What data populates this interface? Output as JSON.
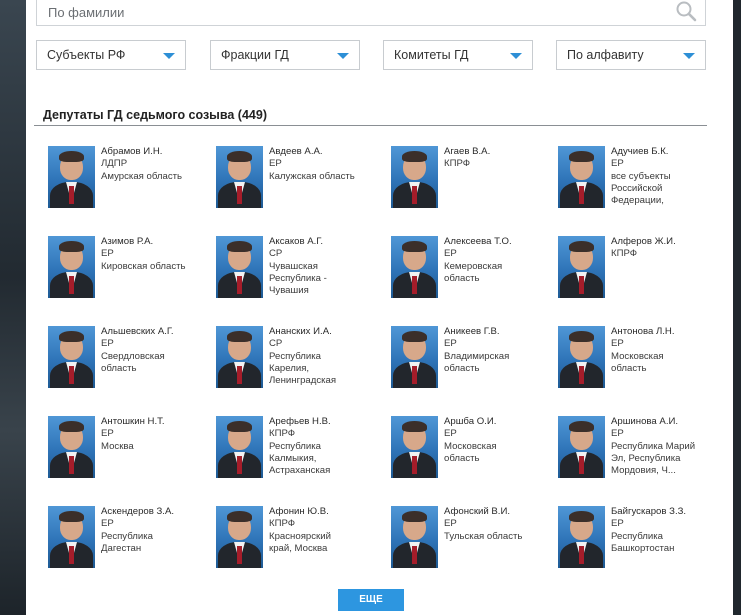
{
  "search": {
    "placeholder": "По фамилии"
  },
  "filters": [
    {
      "label": "Субъекты РФ"
    },
    {
      "label": "Фракции ГД"
    },
    {
      "label": "Комитеты ГД"
    },
    {
      "label": "По алфавиту"
    }
  ],
  "section": {
    "title": "Депутаты ГД седьмого созыва (449)"
  },
  "deputies": [
    {
      "name": "Абрамов И.Н.",
      "party": "ЛДПР",
      "region": [
        "Амурская область"
      ]
    },
    {
      "name": "Авдеев А.А.",
      "party": "ЕР",
      "region": [
        "Калужская область"
      ]
    },
    {
      "name": "Агаев В.А.",
      "party": "КПРФ",
      "region": []
    },
    {
      "name": "Адучиев Б.К.",
      "party": "ЕР",
      "region": [
        "все субъекты",
        "Российской",
        "Федерации,"
      ]
    },
    {
      "name": "Азимов Р.А.",
      "party": "ЕР",
      "region": [
        "Кировская область"
      ]
    },
    {
      "name": "Аксаков А.Г.",
      "party": "СР",
      "region": [
        "Чувашская",
        "Республика -",
        "Чувашия"
      ]
    },
    {
      "name": "Алексеева Т.О.",
      "party": "ЕР",
      "region": [
        "Кемеровская",
        "область"
      ]
    },
    {
      "name": "Алферов Ж.И.",
      "party": "КПРФ",
      "region": []
    },
    {
      "name": "Альшевских А.Г.",
      "party": "ЕР",
      "region": [
        "Свердловская",
        "область"
      ]
    },
    {
      "name": "Ананских И.А.",
      "party": "СР",
      "region": [
        "Республика",
        "Карелия,",
        "Ленинградская"
      ]
    },
    {
      "name": "Аникеев Г.В.",
      "party": "ЕР",
      "region": [
        "Владимирская",
        "область"
      ]
    },
    {
      "name": "Антонова Л.Н.",
      "party": "ЕР",
      "region": [
        "Московская",
        "область"
      ]
    },
    {
      "name": "Антошкин Н.Т.",
      "party": "ЕР",
      "region": [
        "Москва"
      ]
    },
    {
      "name": "Арефьев Н.В.",
      "party": "КПРФ",
      "region": [
        "Республика",
        "Калмыкия,",
        "Астраханская"
      ]
    },
    {
      "name": "Аршба О.И.",
      "party": "ЕР",
      "region": [
        "Московская",
        "область"
      ]
    },
    {
      "name": "Аршинова А.И.",
      "party": "ЕР",
      "region": [
        "Республика Марий",
        "Эл, Республика",
        "Мордовия, Ч..."
      ]
    },
    {
      "name": "Аскендеров З.А.",
      "party": "ЕР",
      "region": [
        "Республика",
        "Дагестан"
      ]
    },
    {
      "name": "Афонин Ю.В.",
      "party": "КПРФ",
      "region": [
        "Красноярский",
        "край, Москва"
      ]
    },
    {
      "name": "Афонский В.И.",
      "party": "ЕР",
      "region": [
        "Тульская область"
      ]
    },
    {
      "name": "Байгускаров З.З.",
      "party": "ЕР",
      "region": [
        "Республика",
        "Башкортостан"
      ]
    }
  ],
  "more_button": {
    "label": "ЕЩЕ"
  }
}
